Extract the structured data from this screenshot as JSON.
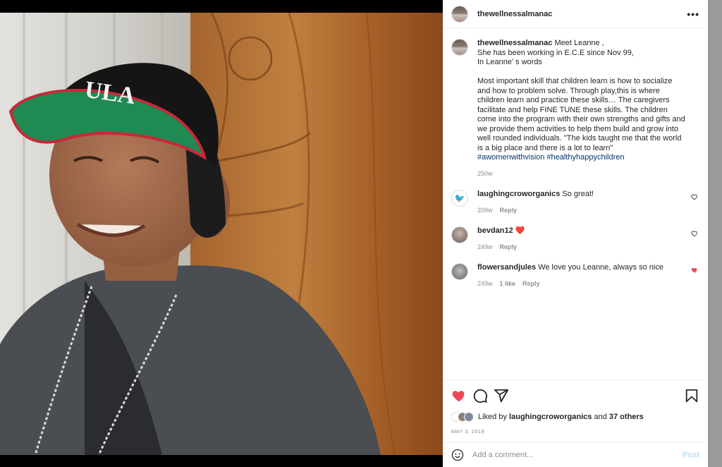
{
  "post": {
    "username": "thewellnessalmanac",
    "more_icon": "more-horizontal-icon",
    "caption_text": "Meet Leanne ,\nShe has been working in E.C.E since Nov 99,\nIn Leanne’ s words\n\nMost important skill that children learn is how to socialize and how to problem solve. Through play,this is where children learn and practice these skills… The caregivers facilitate and help FINE TUNE these skills. The children come into the program with their own strengths and gifts and we provide them activities to help them build and grow into well rounded individuals. \"The kids taught me that the world is a big place and there is a lot to learn\"",
    "hashtags": "#awomenwithvision #healthyhappychildren",
    "caption_age": "250w"
  },
  "comments": [
    {
      "username": "laughingcroworganics",
      "text": "So great!",
      "age": "209w",
      "likes": "",
      "reply": "Reply",
      "liked": false
    },
    {
      "username": "bevdan12",
      "text": "❤️",
      "age": "249w",
      "likes": "",
      "reply": "Reply",
      "liked": false
    },
    {
      "username": "flowersandjules",
      "text": "We love you Leanne, always so nice",
      "age": "249w",
      "likes": "1 like",
      "reply": "Reply",
      "liked": true
    }
  ],
  "actions": {
    "icons": [
      "heart-filled-icon",
      "comment-icon",
      "share-icon",
      "bookmark-icon"
    ],
    "liked_prefix": "Liked by",
    "liked_user": "laughingcroworganics",
    "liked_and": "and",
    "liked_others": "37 others",
    "date": "MAY 3, 2018"
  },
  "add_comment": {
    "placeholder": "Add a comment...",
    "post_label": "Post"
  },
  "colors": {
    "like_red": "#ed4956",
    "hashtag_blue": "#00376b",
    "muted": "#8e8e8e",
    "post_disabled": "#b2dffc"
  }
}
